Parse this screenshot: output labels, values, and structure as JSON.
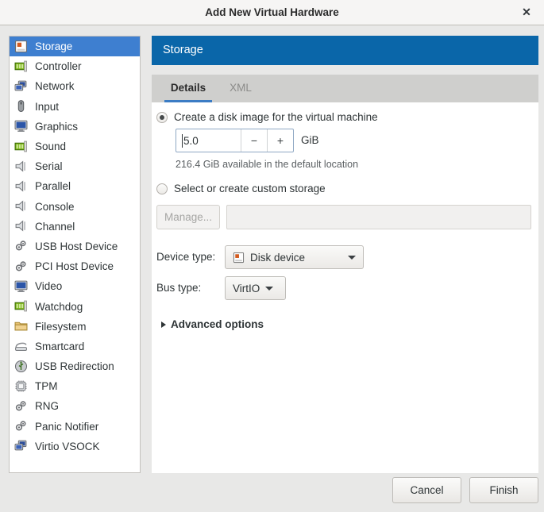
{
  "window": {
    "title": "Add New Virtual Hardware",
    "close_label": "✕"
  },
  "sidebar": {
    "items": [
      {
        "label": "Storage",
        "icon": "disk-icon",
        "selected": true
      },
      {
        "label": "Controller",
        "icon": "card-icon",
        "selected": false
      },
      {
        "label": "Network",
        "icon": "network-icon",
        "selected": false
      },
      {
        "label": "Input",
        "icon": "mouse-icon",
        "selected": false
      },
      {
        "label": "Graphics",
        "icon": "monitor-icon",
        "selected": false
      },
      {
        "label": "Sound",
        "icon": "card-icon",
        "selected": false
      },
      {
        "label": "Serial",
        "icon": "port-icon",
        "selected": false
      },
      {
        "label": "Parallel",
        "icon": "port-icon",
        "selected": false
      },
      {
        "label": "Console",
        "icon": "port-icon",
        "selected": false
      },
      {
        "label": "Channel",
        "icon": "port-icon",
        "selected": false
      },
      {
        "label": "USB Host Device",
        "icon": "gears-icon",
        "selected": false
      },
      {
        "label": "PCI Host Device",
        "icon": "gears-icon",
        "selected": false
      },
      {
        "label": "Video",
        "icon": "monitor-icon",
        "selected": false
      },
      {
        "label": "Watchdog",
        "icon": "card-icon",
        "selected": false
      },
      {
        "label": "Filesystem",
        "icon": "folder-icon",
        "selected": false
      },
      {
        "label": "Smartcard",
        "icon": "smartcard-icon",
        "selected": false
      },
      {
        "label": "USB Redirection",
        "icon": "usb-icon",
        "selected": false
      },
      {
        "label": "TPM",
        "icon": "chip-icon",
        "selected": false
      },
      {
        "label": "RNG",
        "icon": "gears-icon",
        "selected": false
      },
      {
        "label": "Panic Notifier",
        "icon": "gears-icon",
        "selected": false
      },
      {
        "label": "Virtio VSOCK",
        "icon": "network-icon",
        "selected": false
      }
    ]
  },
  "panel": {
    "banner_title": "Storage",
    "tabs": [
      {
        "label": "Details",
        "active": true
      },
      {
        "label": "XML",
        "active": false
      }
    ],
    "create_disk": {
      "radio_label": "Create a disk image for the virtual machine",
      "selected": true,
      "size_value": "5.0",
      "minus_label": "−",
      "plus_label": "+",
      "unit_label": "GiB",
      "hint": "216.4 GiB available in the default location"
    },
    "custom_storage": {
      "radio_label": "Select or create custom storage",
      "selected": false,
      "manage_label": "Manage...",
      "path_value": ""
    },
    "device_type": {
      "label": "Device type:",
      "value": "Disk device"
    },
    "bus_type": {
      "label": "Bus type:",
      "value": "VirtIO"
    },
    "advanced": {
      "label": "Advanced options",
      "expanded": false
    }
  },
  "footer": {
    "cancel_label": "Cancel",
    "finish_label": "Finish"
  },
  "colors": {
    "banner_blue": "#0a66a9",
    "selection_blue": "#3e7fd0",
    "tab_underline": "#3b7cc4",
    "dialog_bg": "#e8e8e7"
  }
}
